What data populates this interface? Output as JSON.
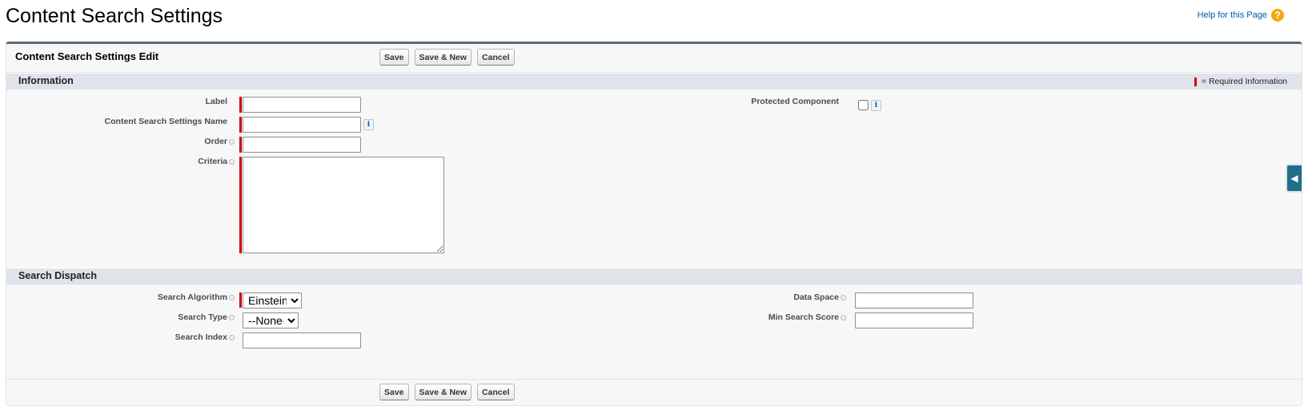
{
  "page": {
    "title": "Content Search Settings",
    "help_link": "Help for this Page",
    "help_icon": "?"
  },
  "form": {
    "title": "Content Search Settings Edit",
    "buttons": {
      "save": "Save",
      "save_new": "Save & New",
      "cancel": "Cancel"
    }
  },
  "information": {
    "section_title": "Information",
    "required_info": "= Required Information",
    "fields": {
      "label": {
        "label": "Label",
        "value": ""
      },
      "name": {
        "label": "Content Search Settings Name",
        "value": ""
      },
      "order": {
        "label": "Order",
        "value": ""
      },
      "criteria": {
        "label": "Criteria",
        "value": ""
      },
      "protected": {
        "label": "Protected Component",
        "checked": false
      }
    },
    "info_glyph": "i"
  },
  "search_dispatch": {
    "section_title": "Search Dispatch",
    "fields": {
      "algorithm": {
        "label": "Search Algorithm",
        "selected": "Einstein"
      },
      "type": {
        "label": "Search Type",
        "selected": "--None--"
      },
      "index": {
        "label": "Search Index",
        "value": ""
      },
      "data_space": {
        "label": "Data Space",
        "value": ""
      },
      "min_score": {
        "label": "Min Search Score",
        "value": ""
      }
    }
  },
  "colors": {
    "required": "#cc0000",
    "link": "#015ba7",
    "section_bg": "#dfe3ea",
    "block_border_top": "#5b6a78",
    "help_icon": "#f2a90f",
    "side_tab": "#1f6f8b"
  },
  "icons": {
    "help": "question-circle-icon",
    "info": "info-icon",
    "field_help": "help-dot-icon",
    "side_tab": "caret-left-icon"
  }
}
